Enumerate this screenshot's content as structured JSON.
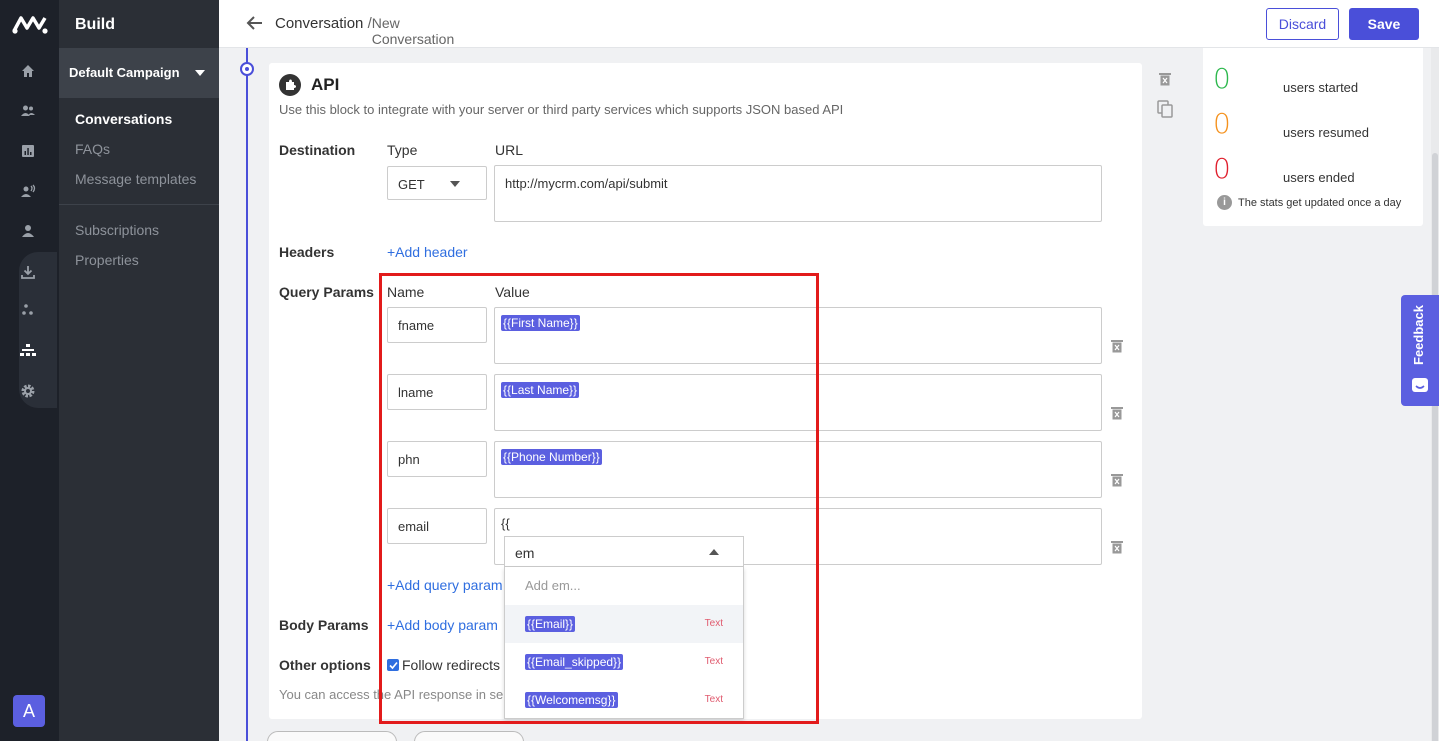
{
  "app": {
    "section_title": "Build",
    "avatar_letter": "A"
  },
  "sidebar": {
    "campaign": "Default Campaign",
    "items": [
      "Conversations",
      "FAQs",
      "Message templates",
      "Subscriptions",
      "Properties"
    ]
  },
  "topbar": {
    "breadcrumb_root": "Conversation",
    "breadcrumb_sep": "/",
    "breadcrumb_current": "New Conversation",
    "discard_label": "Discard",
    "save_label": "Save"
  },
  "block": {
    "title": "API",
    "description": "Use this block to integrate with your server or third party services which supports JSON based API",
    "destination_label": "Destination",
    "type_label": "Type",
    "type_value": "GET",
    "url_label": "URL",
    "url_value": "http://mycrm.com/api/submit",
    "headers_label": "Headers",
    "add_header": "+Add header",
    "query_params_label": "Query Params",
    "name_col": "Name",
    "value_col": "Value",
    "params": [
      {
        "name": "fname",
        "value": "{{First Name}}"
      },
      {
        "name": "lname",
        "value": "{{Last Name}}"
      },
      {
        "name": "phn",
        "value": "{{Phone Number}}"
      },
      {
        "name": "email",
        "value": "{{"
      }
    ],
    "add_query_param": "+Add query param",
    "body_params_label": "Body Params",
    "add_body_param": "+Add body param",
    "other_options_label": "Other options",
    "follow_redirects": "Follow redirects",
    "follow_redirects_checked": true,
    "access_note": "You can access the API response in se"
  },
  "dropdown": {
    "search_value": "em",
    "add_option": "Add em...",
    "options": [
      {
        "label": "{{Email}}",
        "type": "Text"
      },
      {
        "label": "{{Email_skipped}}",
        "type": "Text"
      },
      {
        "label": "{{Welcomemsg}}",
        "type": "Text"
      }
    ]
  },
  "stats": {
    "started_value": "0",
    "started_label": "users started",
    "started_color": "#2db84d",
    "resumed_value": "0",
    "resumed_label": "users resumed",
    "resumed_color": "#f5921e",
    "ended_value": "0",
    "ended_label": "users ended",
    "ended_color": "#e0202e",
    "note": "The stats get updated once a day"
  },
  "feedback_label": "Feedback",
  "colors": {
    "accent": "#4a4fd9",
    "highlight_box": "#e21b1b"
  }
}
